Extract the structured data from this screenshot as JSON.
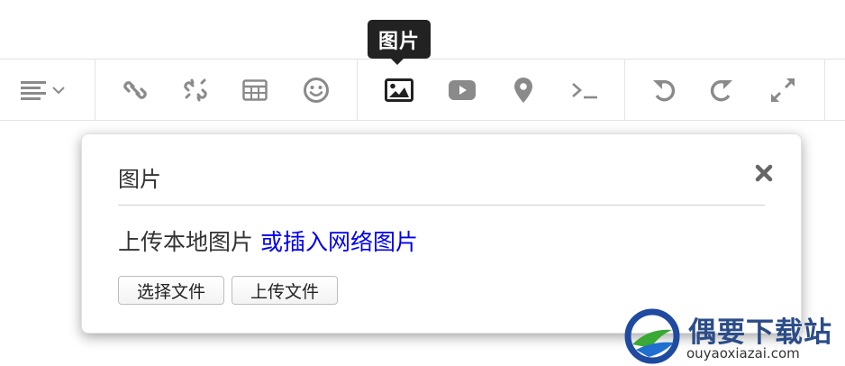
{
  "tooltip": {
    "text": "图片"
  },
  "toolbar": {
    "buttons": [
      {
        "icon": "align-dropdown-icon"
      },
      {
        "icon": "link-icon"
      },
      {
        "icon": "unlink-icon"
      },
      {
        "icon": "table-icon"
      },
      {
        "icon": "emoji-icon"
      },
      {
        "icon": "image-icon",
        "active": true
      },
      {
        "icon": "video-icon"
      },
      {
        "icon": "map-pin-icon"
      },
      {
        "icon": "code-icon"
      },
      {
        "icon": "undo-icon"
      },
      {
        "icon": "redo-icon"
      },
      {
        "icon": "fullscreen-icon"
      }
    ],
    "icon_color": "#8a8a8a",
    "active_color": "#222222"
  },
  "dialog": {
    "title": "图片",
    "upload_text": "上传本地图片",
    "insert_link": "或插入网络图片",
    "choose_button": "选择文件",
    "upload_button": "上传文件",
    "link_color": "#0000ee"
  },
  "watermark": {
    "brand": "偶要下载站",
    "url": "ouyaoxiazai.com"
  }
}
